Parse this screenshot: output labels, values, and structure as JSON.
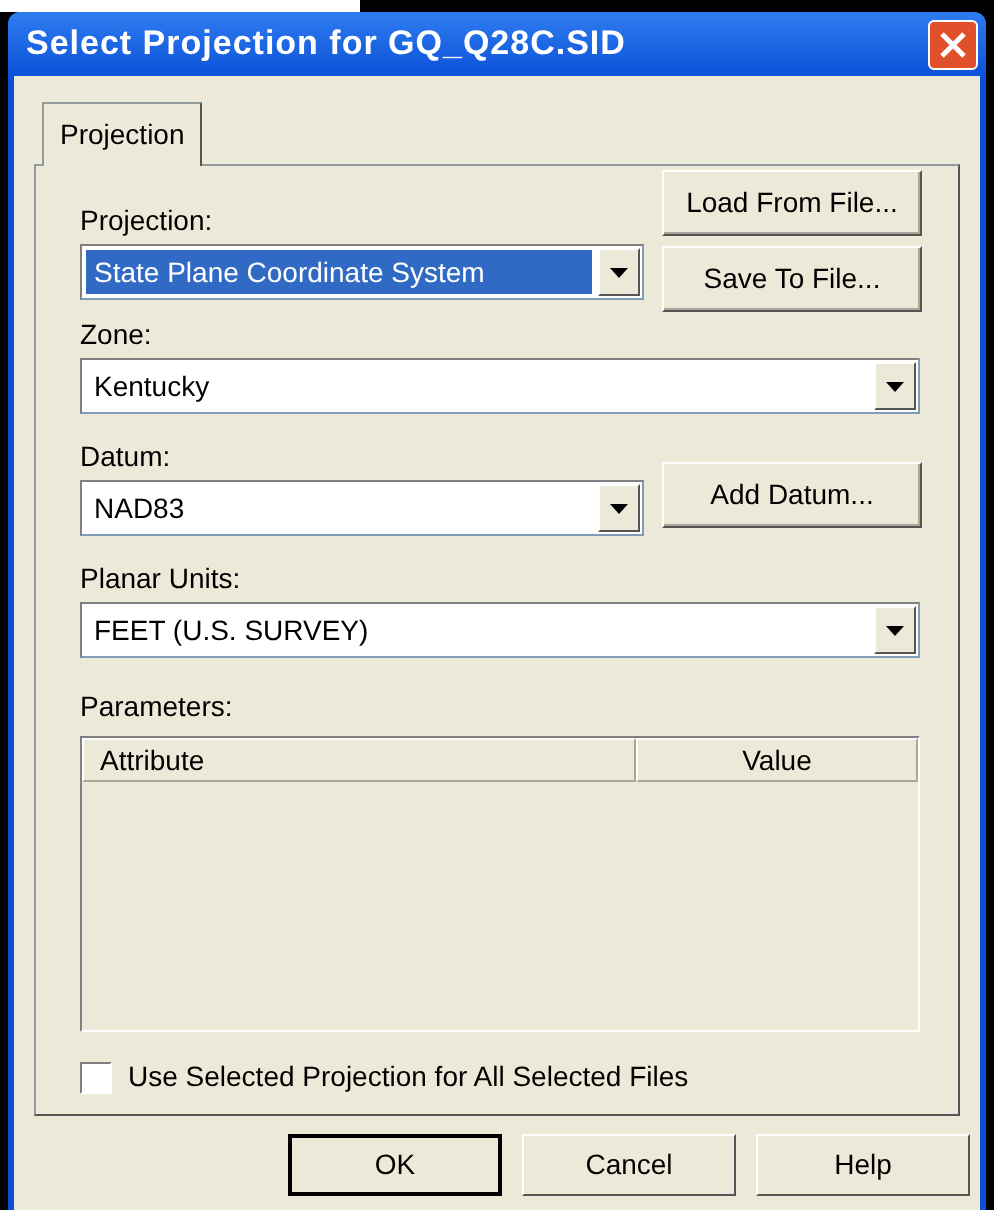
{
  "window": {
    "title": "Select Projection for GQ_Q28C.SID"
  },
  "tabs": [
    {
      "label": "Projection",
      "selected": true
    }
  ],
  "fields": [
    {
      "label": "Projection:",
      "value": "State Plane Coordinate System",
      "focused": true,
      "wide": false
    },
    {
      "label": "Zone:",
      "value": "Kentucky",
      "focused": false,
      "wide": true
    },
    {
      "label": "Datum:",
      "value": "NAD83",
      "focused": false,
      "wide": false
    },
    {
      "label": "Planar Units:",
      "value": "FEET (U.S. SURVEY)",
      "focused": false,
      "wide": true
    }
  ],
  "side_buttons": [
    "Load From File...",
    "Save To File...",
    "Add Datum..."
  ],
  "parameters": {
    "label": "Parameters:",
    "columns": [
      "Attribute",
      "Value"
    ]
  },
  "checkbox": {
    "label": "Use Selected Projection for All Selected Files",
    "checked": false
  },
  "buttons": [
    {
      "label": "OK",
      "default": true
    },
    {
      "label": "Cancel",
      "default": false
    },
    {
      "label": "Help",
      "default": false
    }
  ]
}
